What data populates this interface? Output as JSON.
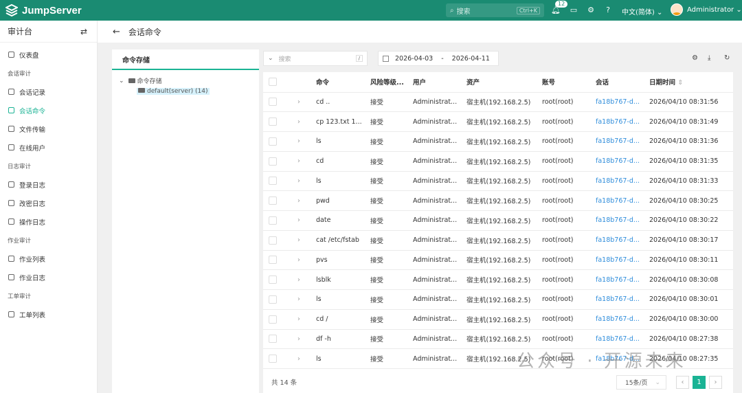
{
  "brand": "JumpServer",
  "topbar": {
    "search_placeholder": "搜索",
    "shortcut": "Ctrl+K",
    "notifications": "12",
    "language": "中文(简体)",
    "user": "Administrator"
  },
  "sidebar": {
    "title": "审计台",
    "items": [
      {
        "type": "item",
        "label": "仪表盘",
        "icon": "dashboard-icon"
      },
      {
        "type": "group",
        "label": "会话审计"
      },
      {
        "type": "item",
        "label": "会话记录",
        "icon": "link-icon"
      },
      {
        "type": "item",
        "label": "会话命令",
        "icon": "terminal-icon",
        "active": true
      },
      {
        "type": "item",
        "label": "文件传输",
        "icon": "file-icon"
      },
      {
        "type": "item",
        "label": "在线用户",
        "icon": "monitor-icon"
      },
      {
        "type": "group",
        "label": "日志审计"
      },
      {
        "type": "item",
        "label": "登录日志",
        "icon": "login-icon"
      },
      {
        "type": "item",
        "label": "改密日志",
        "icon": "lock-icon"
      },
      {
        "type": "item",
        "label": "操作日志",
        "icon": "list-icon"
      },
      {
        "type": "group",
        "label": "作业审计"
      },
      {
        "type": "item",
        "label": "作业列表",
        "icon": "checklist-icon"
      },
      {
        "type": "item",
        "label": "作业日志",
        "icon": "history-icon"
      },
      {
        "type": "group",
        "label": "工单审计"
      },
      {
        "type": "item",
        "label": "工单列表",
        "icon": "ticket-icon"
      }
    ]
  },
  "page": {
    "title": "会话命令"
  },
  "tree": {
    "tab": "命令存储",
    "root": "命令存储",
    "child": "default(server) (14)"
  },
  "toolbar": {
    "search_placeholder": "搜索",
    "search_shortcut": "/",
    "date_start": "2026-04-03",
    "date_sep": "-",
    "date_end": "2026-04-11"
  },
  "table": {
    "columns": [
      "命令",
      "风险等级...",
      "用户",
      "资产",
      "账号",
      "会话",
      "日期时间"
    ],
    "rows": [
      [
        "cd ..",
        "接受",
        "Administrat...",
        "宿主机(192.168.2.5)",
        "root(root)",
        "fa18b767-d...",
        "2026/04/10 08:31:56"
      ],
      [
        "cp 123.txt 1...",
        "接受",
        "Administrat...",
        "宿主机(192.168.2.5)",
        "root(root)",
        "fa18b767-d...",
        "2026/04/10 08:31:49"
      ],
      [
        "ls",
        "接受",
        "Administrat...",
        "宿主机(192.168.2.5)",
        "root(root)",
        "fa18b767-d...",
        "2026/04/10 08:31:36"
      ],
      [
        "cd",
        "接受",
        "Administrat...",
        "宿主机(192.168.2.5)",
        "root(root)",
        "fa18b767-d...",
        "2026/04/10 08:31:35"
      ],
      [
        "ls",
        "接受",
        "Administrat...",
        "宿主机(192.168.2.5)",
        "root(root)",
        "fa18b767-d...",
        "2026/04/10 08:31:33"
      ],
      [
        "pwd",
        "接受",
        "Administrat...",
        "宿主机(192.168.2.5)",
        "root(root)",
        "fa18b767-d...",
        "2026/04/10 08:30:25"
      ],
      [
        "date",
        "接受",
        "Administrat...",
        "宿主机(192.168.2.5)",
        "root(root)",
        "fa18b767-d...",
        "2026/04/10 08:30:22"
      ],
      [
        "cat /etc/fstab",
        "接受",
        "Administrat...",
        "宿主机(192.168.2.5)",
        "root(root)",
        "fa18b767-d...",
        "2026/04/10 08:30:17"
      ],
      [
        "pvs",
        "接受",
        "Administrat...",
        "宿主机(192.168.2.5)",
        "root(root)",
        "fa18b767-d...",
        "2026/04/10 08:30:11"
      ],
      [
        "lsblk",
        "接受",
        "Administrat...",
        "宿主机(192.168.2.5)",
        "root(root)",
        "fa18b767-d...",
        "2026/04/10 08:30:08"
      ],
      [
        "ls",
        "接受",
        "Administrat...",
        "宿主机(192.168.2.5)",
        "root(root)",
        "fa18b767-d...",
        "2026/04/10 08:30:01"
      ],
      [
        "cd /",
        "接受",
        "Administrat...",
        "宿主机(192.168.2.5)",
        "root(root)",
        "fa18b767-d...",
        "2026/04/10 08:30:00"
      ],
      [
        "df -h",
        "接受",
        "Administrat...",
        "宿主机(192.168.2.5)",
        "root(root)",
        "fa18b767-d...",
        "2026/04/10 08:27:38"
      ],
      [
        "ls",
        "接受",
        "Administrat...",
        "宿主机(192.168.2.5)",
        "root(root)",
        "fa18b767-d...",
        "2026/04/10 08:27:35"
      ]
    ]
  },
  "footer": {
    "total": "共 14 条",
    "page_size": "15条/页",
    "current_page": "1"
  },
  "watermark": "公众号 · 开源未来",
  "colors": {
    "brand": "#1a8b72",
    "accent": "#1ab394",
    "link": "#2f8ddb"
  }
}
